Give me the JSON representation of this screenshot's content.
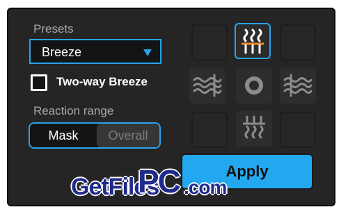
{
  "presets": {
    "label": "Presets",
    "selected": "Breeze"
  },
  "two_way": {
    "label": "Two-way Breeze",
    "checked": false
  },
  "reaction_range": {
    "label": "Reaction range",
    "options": [
      "Mask",
      "Overall"
    ],
    "selected": "Mask"
  },
  "direction_grid": {
    "selected_tile": "top-center",
    "tiles": [
      "empty",
      "heat-top",
      "empty",
      "wind-left",
      "center-ring",
      "wind-right",
      "empty",
      "heat-bottom",
      "empty"
    ]
  },
  "apply": {
    "label": "Apply"
  },
  "watermark": {
    "getfiles": "GetFiles",
    "pc": "PC",
    "com": ".com"
  },
  "colors": {
    "accent": "#2aa3ec",
    "heat_line": "#f08a24",
    "panel": "#252525"
  }
}
